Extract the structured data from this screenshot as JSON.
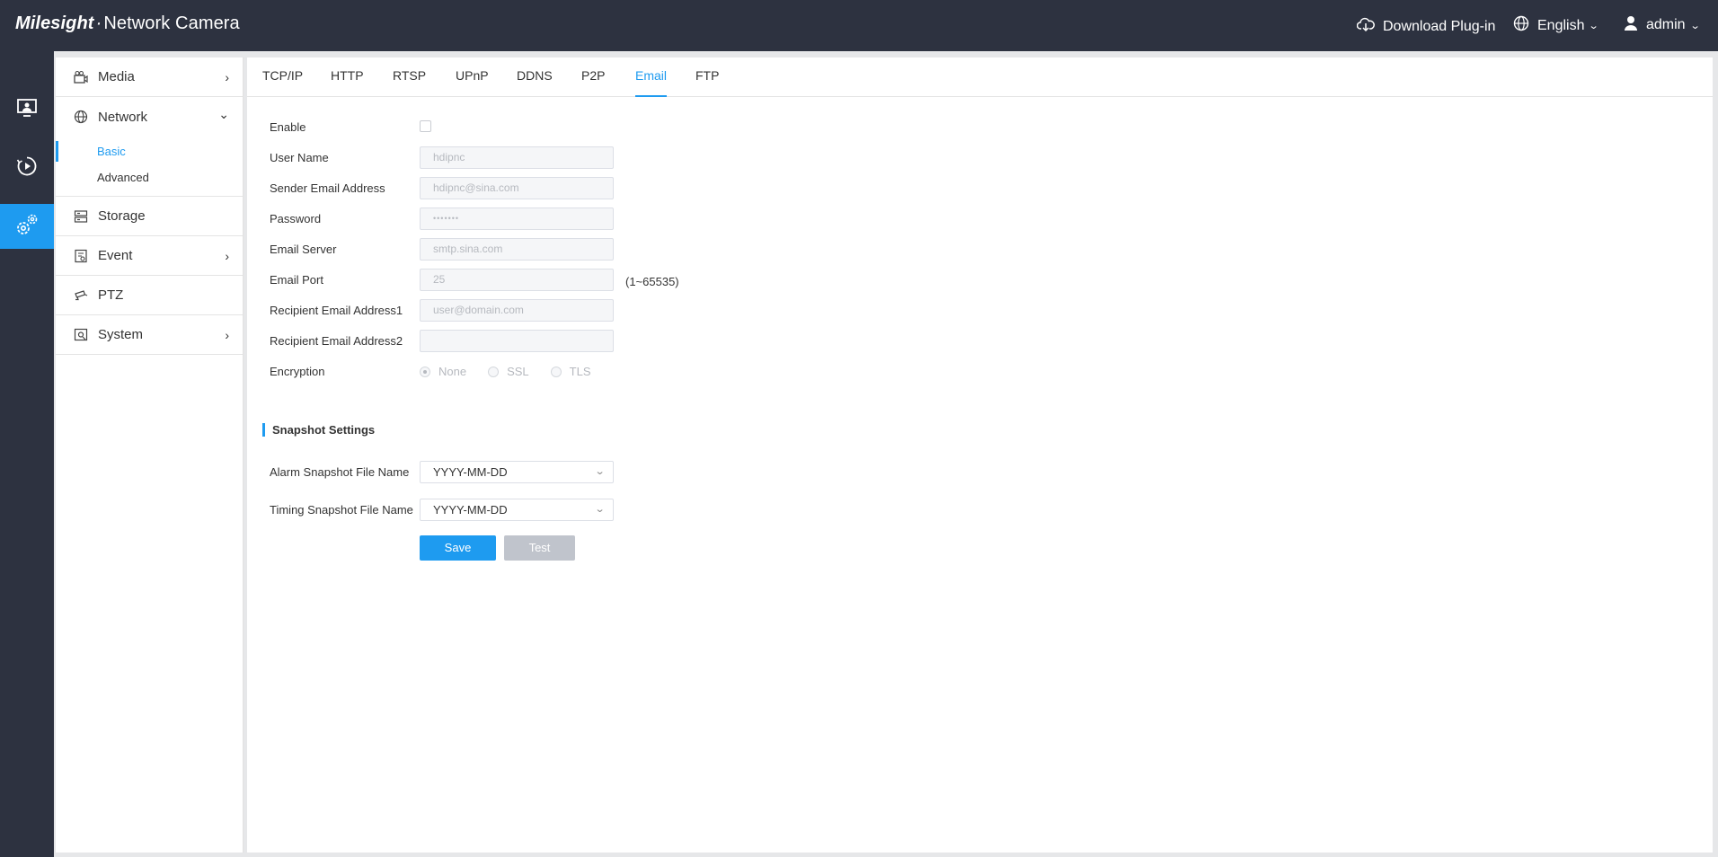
{
  "header": {
    "brand_logo": "Milesight",
    "brand_sep": "·",
    "brand_title": "Network Camera",
    "download_plugin": "Download Plug-in",
    "language": "English",
    "user": "admin"
  },
  "rail": {
    "items": [
      {
        "icon": "live-view-icon"
      },
      {
        "icon": "playback-icon"
      },
      {
        "icon": "settings-icon",
        "active": true
      }
    ]
  },
  "sidebar": {
    "media": "Media",
    "network": "Network",
    "network_sub": [
      "Basic",
      "Advanced"
    ],
    "storage": "Storage",
    "event": "Event",
    "ptz": "PTZ",
    "system": "System"
  },
  "tabs": [
    "TCP/IP",
    "HTTP",
    "RTSP",
    "UPnP",
    "DDNS",
    "P2P",
    "Email",
    "FTP"
  ],
  "active_tab": "Email",
  "form": {
    "enable_label": "Enable",
    "enable_checked": false,
    "user_name_label": "User Name",
    "user_name_value": "hdipnc",
    "sender_label": "Sender Email Address",
    "sender_value": "hdipnc@sina.com",
    "password_label": "Password",
    "password_value": "•••••••",
    "server_label": "Email Server",
    "server_value": "smtp.sina.com",
    "port_label": "Email Port",
    "port_value": "25",
    "port_hint": "(1~65535)",
    "recipient1_label": "Recipient Email Address1",
    "recipient1_placeholder": "user@domain.com",
    "recipient2_label": "Recipient Email Address2",
    "recipient2_value": "",
    "encryption_label": "Encryption",
    "encryption_options": [
      "None",
      "SSL",
      "TLS"
    ],
    "encryption_selected": "None"
  },
  "snapshot": {
    "title": "Snapshot Settings",
    "alarm_label": "Alarm Snapshot File Name",
    "alarm_value": "YYYY-MM-DD",
    "timing_label": "Timing Snapshot File Name",
    "timing_value": "YYYY-MM-DD"
  },
  "buttons": {
    "save": "Save",
    "test": "Test"
  },
  "colors": {
    "accent": "#1e9bf0",
    "header_bg": "#2d3240",
    "disabled_button": "#c0c4cc"
  }
}
